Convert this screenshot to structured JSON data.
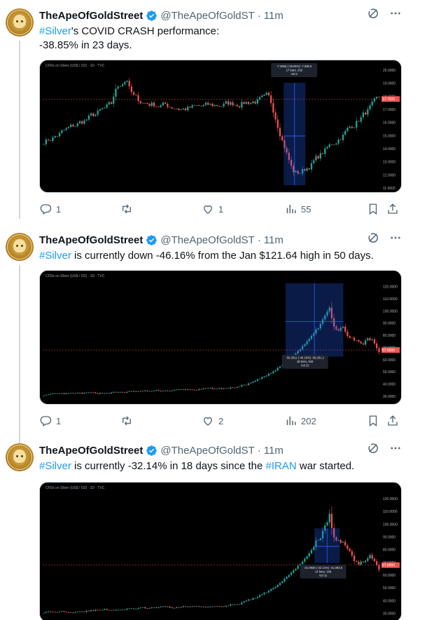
{
  "colors": {
    "accent": "#1d9bf0",
    "muted": "#536471",
    "text": "#0f1419",
    "up": "#26a69a",
    "down": "#ef5350"
  },
  "tweets": [
    {
      "author": {
        "display_name": "TheApeOfGoldStreet",
        "handle": "@TheApeOfGoldST",
        "time": "11m"
      },
      "text_parts": [
        {
          "t": "#Silver",
          "tag": true
        },
        {
          "t": "'s COVID CRASH performance:\n-38.85% in 23 days.",
          "tag": false
        }
      ],
      "media": {
        "chart_header": "CFDs on Silver (US$ / OZ) · 1D · TVC",
        "measure_box": [
          "-7.3855 (-38.85%) -7,385.5",
          "17 bars, 23d",
          "Vol 0"
        ],
        "price_labels": [
          "20.0000",
          "19.0000",
          "18.0000",
          "17.0000",
          "16.0000",
          "15.0000",
          "14.0000",
          "13.0000",
          "12.0000",
          "11.0000"
        ],
        "current_price": "17.7920"
      },
      "actions": {
        "replies": "1",
        "reposts": "",
        "likes": "1",
        "views": "55"
      }
    },
    {
      "author": {
        "display_name": "TheApeOfGoldStreet",
        "handle": "@TheApeOfGoldST",
        "time": "11m"
      },
      "text_parts": [
        {
          "t": "#Silver",
          "tag": true
        },
        {
          "t": " is currently down -46.16% from the Jan $121.64 high in 50 days.",
          "tag": false
        }
      ],
      "media": {
        "chart_header": "CFDs on Silver (US$ / OZ) · 1D · TVC",
        "measure_box": [
          "-56.2811 (-46.16%) -56,281.1",
          "35 bars, 50d",
          "Vol 22"
        ],
        "price_labels": [
          "120.0000",
          "110.0000",
          "100.0000",
          "90.0000",
          "80.0000",
          "70.0000",
          "60.0000",
          "50.0000",
          "40.0000",
          "30.0000"
        ],
        "current_price": "67.8990"
      },
      "actions": {
        "replies": "1",
        "reposts": "",
        "likes": "2",
        "views": "202"
      }
    },
    {
      "author": {
        "display_name": "TheApeOfGoldStreet",
        "handle": "@TheApeOfGoldST",
        "time": "11m"
      },
      "text_parts": [
        {
          "t": "#Silver",
          "tag": true
        },
        {
          "t": " is currently -32.14% in 18 days since the ",
          "tag": false
        },
        {
          "t": "#IRAN",
          "tag": true
        },
        {
          "t": " war started.",
          "tag": false
        }
      ],
      "media": {
        "chart_header": "CFDs on Silver (US$ / OZ) · 1D · TVC",
        "measure_box": [
          "-31.0936 (-32.14%) -31,093.6",
          "14 bars, 18d",
          "Vol 11"
        ],
        "price_labels": [
          "120.0000",
          "110.0000",
          "100.0000",
          "90.0000",
          "80.0000",
          "70.0000",
          "60.0000",
          "50.0000",
          "40.0000",
          "30.0000"
        ],
        "current_price": "67.8990"
      },
      "actions": {
        "replies": "",
        "reposts": "",
        "likes": "",
        "views": ""
      }
    }
  ]
}
